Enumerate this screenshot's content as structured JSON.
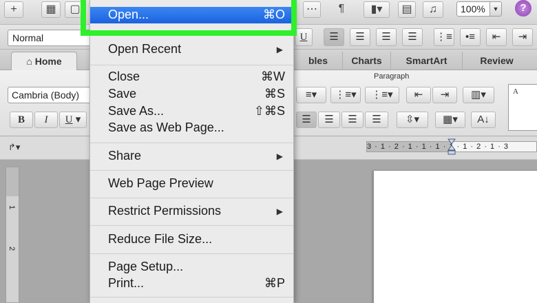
{
  "toolbar": {
    "zoom_value": "100%",
    "help_label": "?",
    "pilcrow_label": "¶"
  },
  "format_bar": {
    "style_value": "Normal"
  },
  "ribbon": {
    "tabs": [
      "Home",
      "bles",
      "Charts",
      "SmartArt",
      "Review"
    ],
    "paragraph_group_label": "Paragraph",
    "font_value": "Cambria (Body)",
    "style_preview_text": "A"
  },
  "ruler": {
    "tab_selector": "↱▾",
    "scale": "3 · 1 · 2 · 1 · 1 · 1 · 1 · 1 · 2 · 1 · 3"
  },
  "vertical_ruler": {
    "ticks": [
      "1",
      "2"
    ]
  },
  "file_menu": {
    "items": [
      {
        "label": "Open...",
        "shortcut": "⌘O",
        "highlighted": true
      },
      {
        "label": "Open Recent",
        "submenu": true
      },
      {
        "label": "Close",
        "shortcut": "⌘W"
      },
      {
        "label": "Save",
        "shortcut": "⌘S"
      },
      {
        "label": "Save As...",
        "shortcut": "⇧⌘S"
      },
      {
        "label": "Save as Web Page..."
      },
      {
        "label": "Share",
        "submenu": true
      },
      {
        "label": "Web Page Preview"
      },
      {
        "label": "Restrict Permissions",
        "submenu": true
      },
      {
        "label": "Reduce File Size..."
      },
      {
        "label": "Page Setup..."
      },
      {
        "label": "Print...",
        "shortcut": "⌘P"
      }
    ],
    "submenu_arrow": "▶"
  },
  "colors": {
    "highlight": "#1b63df",
    "annotation_box": "#2ff02a"
  }
}
